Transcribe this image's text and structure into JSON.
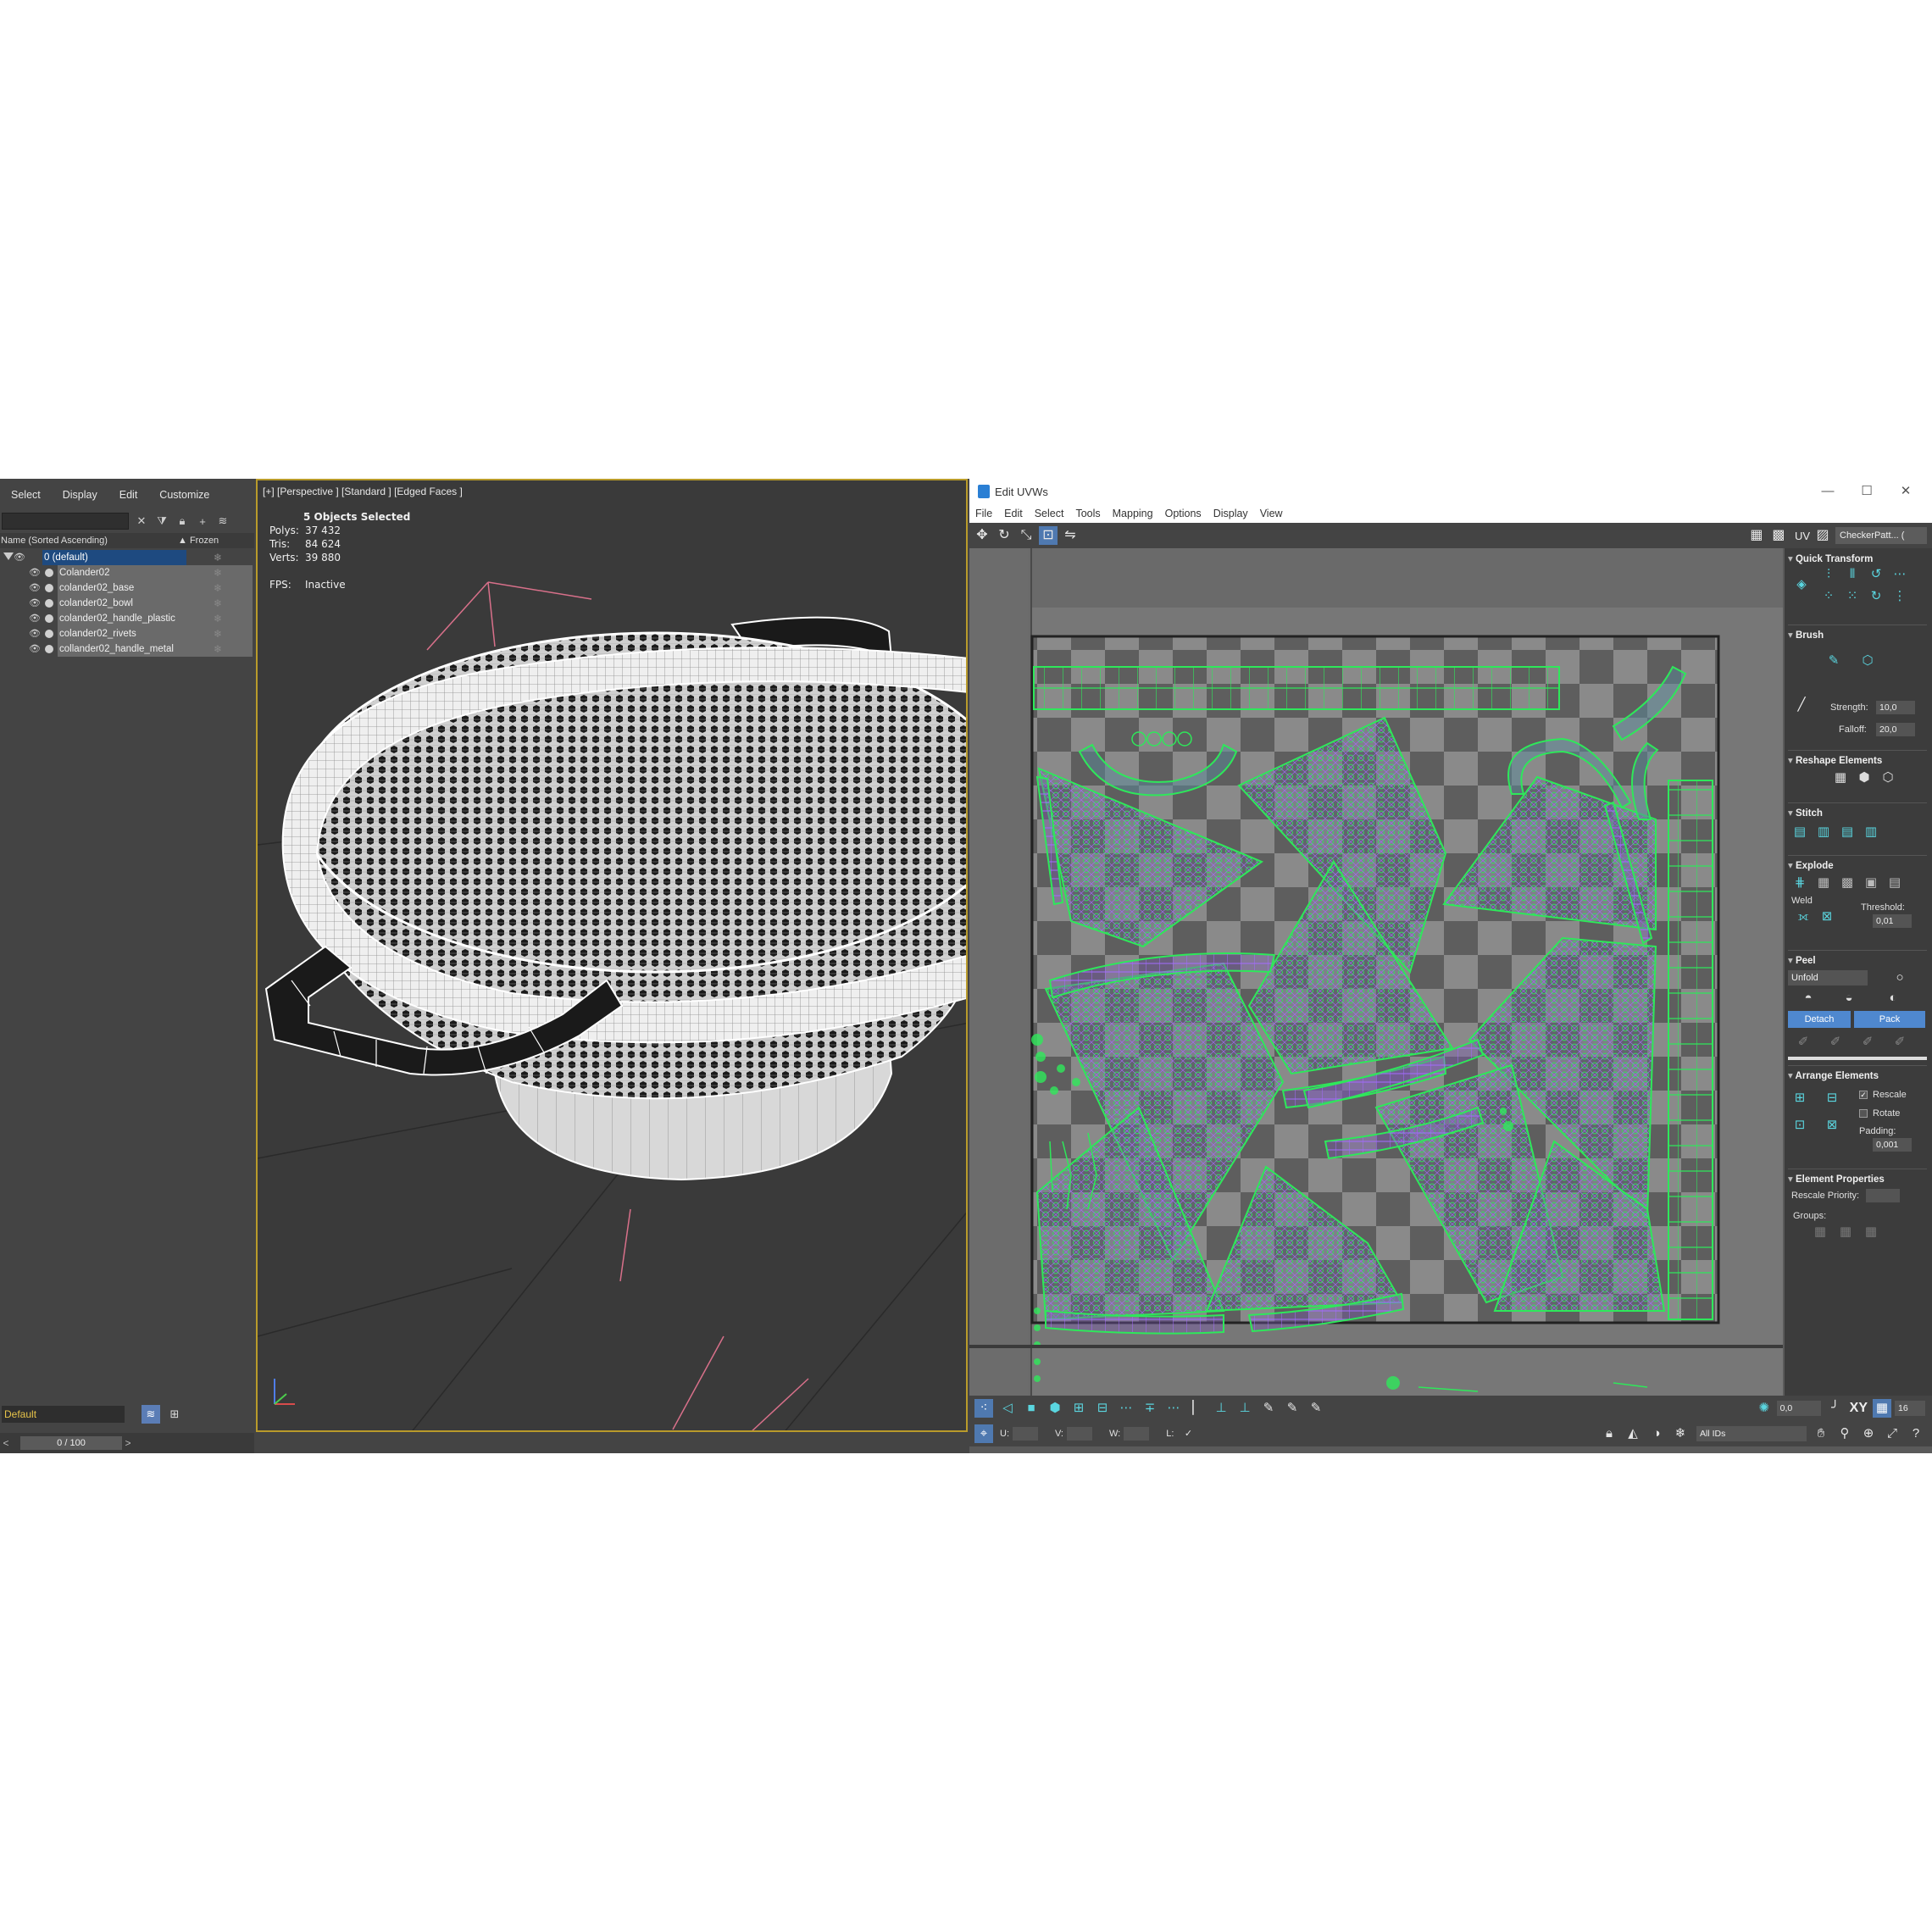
{
  "explorer": {
    "menu": [
      "Select",
      "Display",
      "Edit",
      "Customize"
    ],
    "col_name": "Name (Sorted Ascending)",
    "col_frozen": "▲ Frozen",
    "layer": "0 (default)",
    "objects": [
      "Colander02",
      "colander02_base",
      "colander02_bowl",
      "colander02_handle_plastic",
      "colander02_rivets",
      "collander02_handle_metal"
    ],
    "layer_field": "Default",
    "frame": "0 / 100",
    "prev": "<",
    "next": ">"
  },
  "viewport": {
    "label": "[+] [Perspective ] [Standard ] [Edged Faces ]",
    "selected": "5 Objects Selected",
    "polys_label": "Polys:",
    "polys": "37 432",
    "tris_label": "Tris:",
    "tris": "84 624",
    "verts_label": "Verts:",
    "verts": "39 880",
    "fps_label": "FPS:",
    "fps": "Inactive"
  },
  "uv": {
    "title": "Edit UVWs",
    "window_buttons": [
      "—",
      "☐",
      "✕"
    ],
    "menu": [
      "File",
      "Edit",
      "Select",
      "Tools",
      "Mapping",
      "Options",
      "Display",
      "View"
    ],
    "uv_label": "UV",
    "texture_combo": "CheckerPatt... ( Checker )",
    "panel": {
      "quick_transform": "Quick Transform",
      "brush": "Brush",
      "strength_label": "Strength:",
      "strength": "10,0",
      "falloff_label": "Falloff:",
      "falloff": "20,0",
      "reshape": "Reshape Elements",
      "stitch": "Stitch",
      "explode": "Explode",
      "weld": "Weld",
      "threshold_label": "Threshold:",
      "threshold": "0,01",
      "peel": "Peel",
      "unfold": "Unfold",
      "detach": "Detach",
      "pack": "Pack",
      "arrange": "Arrange Elements",
      "rescale": "Rescale",
      "rotate": "Rotate",
      "padding_label": "Padding:",
      "padding": "0,001",
      "element_props": "Element Properties",
      "rescale_priority": "Rescale Priority:",
      "groups": "Groups:"
    },
    "bottom": {
      "spin_value": "0,0",
      "xy": "XY",
      "grid_value": "16",
      "u_label": "U:",
      "v_label": "V:",
      "w_label": "W:",
      "l_label": "L:",
      "ids": "All IDs"
    }
  },
  "colors": {
    "accent": "#4f79b0",
    "viewport_border": "#b99b2b",
    "uv_green": "#2ee85a",
    "uv_purple": "#a36bff",
    "icon_cyan": "#5ad6e0"
  }
}
